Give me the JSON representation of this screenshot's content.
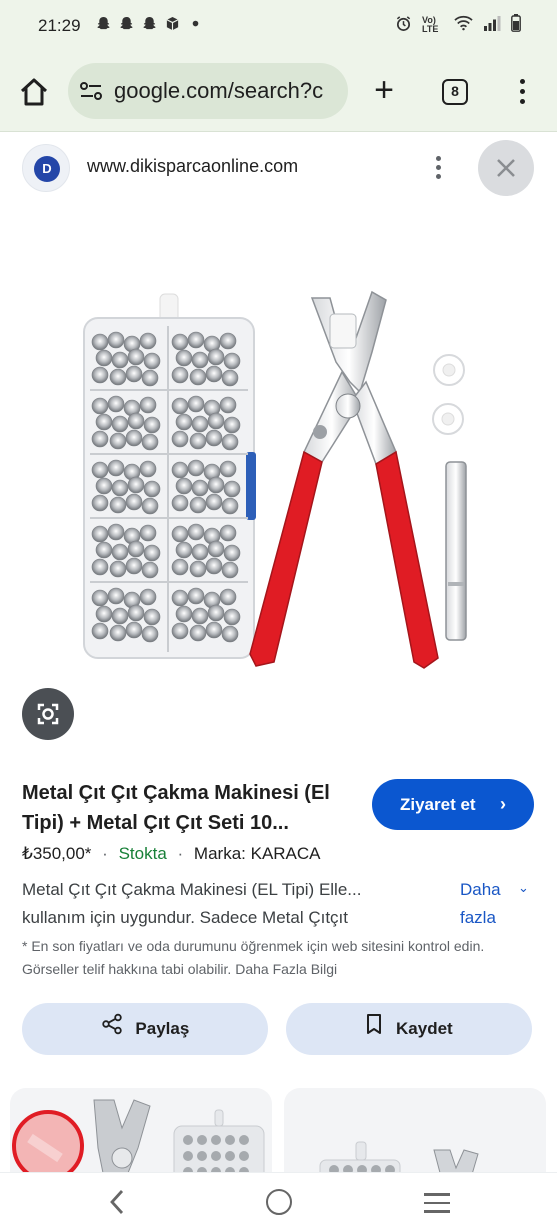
{
  "status_bar": {
    "time": "21:29",
    "indicator_icons": [
      "snapchat-icon",
      "snapchat-icon",
      "snapchat-icon",
      "box-icon",
      "dot-icon"
    ],
    "right_icons": [
      "alarm-icon",
      "volte-icon",
      "wifi-icon",
      "signal-icon",
      "battery-icon"
    ],
    "volte_label": "Vo) LTE"
  },
  "browser": {
    "url": "google.com/search?c",
    "tab_count": "8"
  },
  "site": {
    "name": "www.dikisparcaonline.com",
    "logo_text": "D"
  },
  "product": {
    "title": "Metal Çıt Çıt Çakma Makinesi (El Tipi) + Metal Çıt Çıt Seti 10...",
    "visit_label": "Ziyaret et",
    "price": "₺350,00*",
    "stock": "Stokta",
    "brand": "Marka: KARACA",
    "description": "Metal Çıt Çıt Çakma Makinesi (EL Tipi) Elle... kullanım için uygundur. Sadece Metal Çıtçıt",
    "more_label": "Daha fazla",
    "note": "* En son fiyatları ve oda durumunu öğrenmek için web sitesini kontrol edin. Görseller telif hakkına tabi olabilir. Daha Fazla Bilgi",
    "share_label": "Paylaş",
    "save_label": "Kaydet"
  },
  "colors": {
    "toolbar_bg": "#eef4ea",
    "urlbar_bg": "#dbe6d6",
    "accent_blue": "#0b57d0",
    "stock_green": "#188038",
    "action_btn_bg": "#dde6f5",
    "plier_red": "#e01c24"
  }
}
